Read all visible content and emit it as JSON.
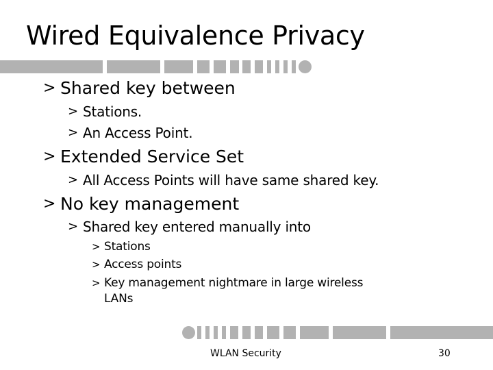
{
  "slide": {
    "title": "Wired Equivalence Privacy",
    "bullet_glyph": ">",
    "bullets": [
      {
        "text": "Shared key between"
      },
      {
        "text": "Stations."
      },
      {
        "text": "An Access Point."
      },
      {
        "text": "Extended Service Set"
      },
      {
        "text": "All Access Points will have same shared key."
      },
      {
        "text": "No key management"
      },
      {
        "text": "Shared key entered manually into"
      },
      {
        "text": "Stations"
      },
      {
        "text": "Access points"
      },
      {
        "text": "Key management nightmare in large wireless"
      },
      {
        "text": "LANs"
      }
    ],
    "footer": {
      "center_text": "WLAN Security",
      "page_number": "30"
    },
    "colors": {
      "decor_bar": "#b2b2b2",
      "text": "#000000",
      "background": "#ffffff"
    }
  }
}
